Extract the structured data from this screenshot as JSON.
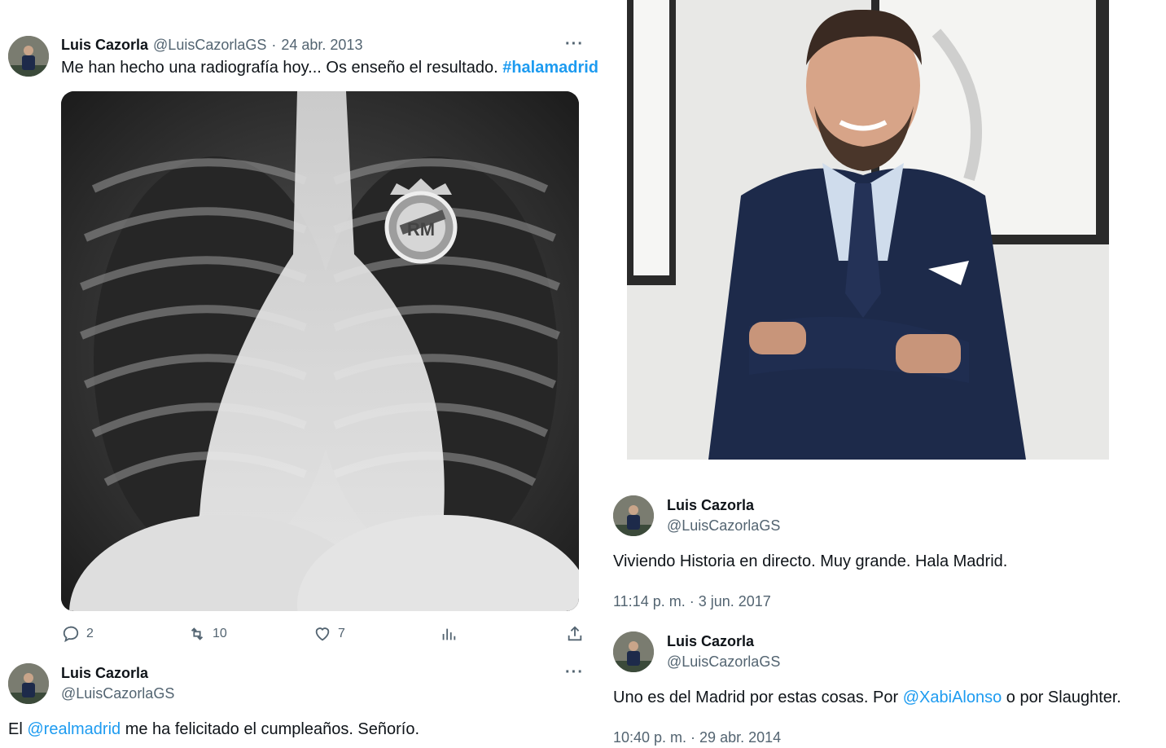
{
  "tweet1": {
    "name": "Luis Cazorla",
    "handle": "@LuisCazorlaGS",
    "separator": "·",
    "date": "24 abr. 2013",
    "more": "···",
    "text": "Me han hecho una radiografía hoy... Os enseño el resultado.",
    "hashtag": "#halamadrid",
    "media_icon": "xray-chest-image",
    "actions": {
      "replies": "2",
      "retweets": "10",
      "likes": "7"
    }
  },
  "tweet2": {
    "name": "Luis Cazorla",
    "handle": "@LuisCazorlaGS",
    "more": "···",
    "text_before": "El",
    "mention": "@realmadrid",
    "text_after": "me ha felicitado el cumpleaños. Señorío."
  },
  "photo": {
    "icon": "portrait-photo"
  },
  "tweet3": {
    "name": "Luis Cazorla",
    "handle": "@LuisCazorlaGS",
    "text": "Viviendo Historia en directo. Muy grande. Hala Madrid.",
    "timestamp": "11:14 p. m. · 3 jun. 2017"
  },
  "tweet4": {
    "name": "Luis Cazorla",
    "handle": "@LuisCazorlaGS",
    "text_before": "Uno es del Madrid por estas cosas. Por",
    "mention": "@XabiAlonso",
    "text_after": "o por Slaughter.",
    "timestamp": "10:40 p. m. · 29 abr. 2014"
  },
  "colors": {
    "link": "#1d9bf0",
    "secondary_text": "#536471",
    "primary_text": "#0f1419",
    "suit_navy": "#1d2a4a"
  }
}
